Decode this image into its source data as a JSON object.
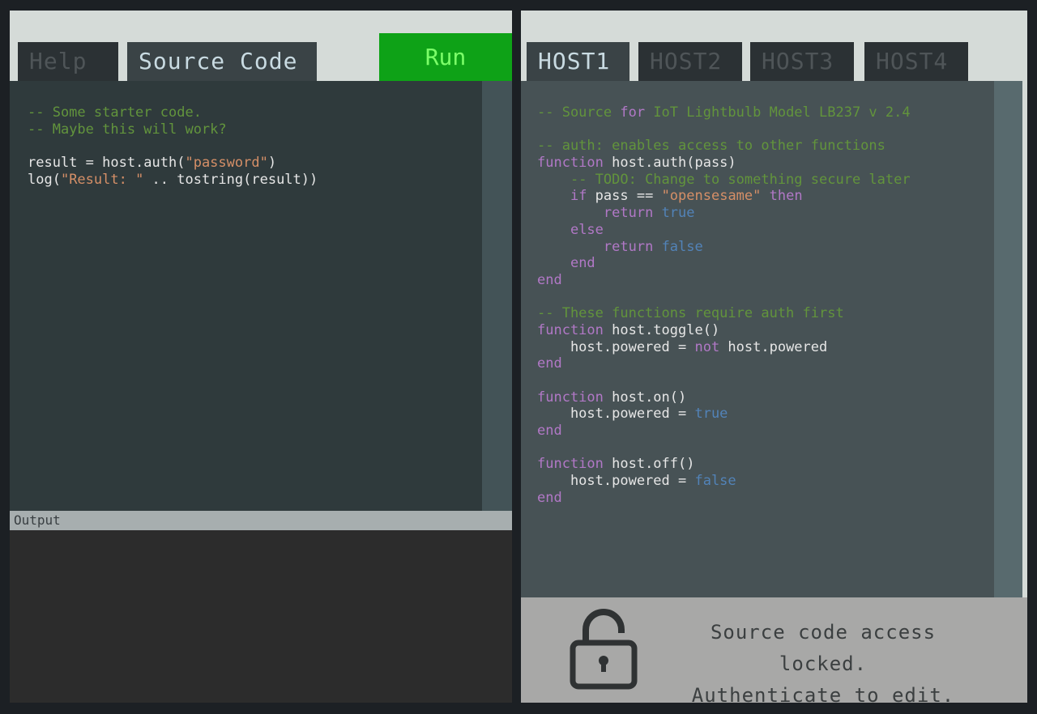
{
  "left": {
    "tabs": [
      "Help",
      "Source Code"
    ],
    "active_tab": "Source Code",
    "run_label": "Run",
    "output_label": "Output",
    "code_lines": [
      [
        [
          "cm",
          "-- Some starter code."
        ]
      ],
      [
        [
          "cm",
          "-- Maybe this will work?"
        ]
      ],
      [],
      [
        [
          "tx",
          "result = host.auth("
        ],
        [
          "str",
          "\"password\""
        ],
        [
          "tx",
          ")"
        ]
      ],
      [
        [
          "tx",
          "log("
        ],
        [
          "str",
          "\"Result: \""
        ],
        [
          "tx",
          " .. tostring(result))"
        ]
      ]
    ]
  },
  "right": {
    "tabs": [
      "HOST1",
      "HOST2",
      "HOST3",
      "HOST4"
    ],
    "active_tab": "HOST1",
    "code_lines": [
      [
        [
          "cm",
          "-- Source "
        ],
        [
          "kw",
          "for"
        ],
        [
          "cm",
          " IoT Lightbulb Model LB237 v 2.4"
        ]
      ],
      [],
      [
        [
          "cm",
          "-- auth: enables access to other functions"
        ]
      ],
      [
        [
          "kw",
          "function"
        ],
        [
          "tx",
          " host.auth(pass)"
        ]
      ],
      [
        [
          "tx",
          "    "
        ],
        [
          "cm",
          "-- TODO: Change to something secure later"
        ]
      ],
      [
        [
          "tx",
          "    "
        ],
        [
          "kw",
          "if"
        ],
        [
          "tx",
          " pass == "
        ],
        [
          "str",
          "\"opensesame\""
        ],
        [
          "tx",
          " "
        ],
        [
          "kw",
          "then"
        ]
      ],
      [
        [
          "tx",
          "        "
        ],
        [
          "kw",
          "return"
        ],
        [
          "tx",
          " "
        ],
        [
          "bool",
          "true"
        ]
      ],
      [
        [
          "tx",
          "    "
        ],
        [
          "kw",
          "else"
        ]
      ],
      [
        [
          "tx",
          "        "
        ],
        [
          "kw",
          "return"
        ],
        [
          "tx",
          " "
        ],
        [
          "bool",
          "false"
        ]
      ],
      [
        [
          "tx",
          "    "
        ],
        [
          "kw",
          "end"
        ]
      ],
      [
        [
          "kw",
          "end"
        ]
      ],
      [],
      [
        [
          "cm",
          "-- These functions require auth first"
        ]
      ],
      [
        [
          "kw",
          "function"
        ],
        [
          "tx",
          " host.toggle()"
        ]
      ],
      [
        [
          "tx",
          "    host.powered = "
        ],
        [
          "kw",
          "not"
        ],
        [
          "tx",
          " host.powered"
        ]
      ],
      [
        [
          "kw",
          "end"
        ]
      ],
      [],
      [
        [
          "kw",
          "function"
        ],
        [
          "tx",
          " host.on()"
        ]
      ],
      [
        [
          "tx",
          "    host.powered = "
        ],
        [
          "bool",
          "true"
        ]
      ],
      [
        [
          "kw",
          "end"
        ]
      ],
      [],
      [
        [
          "kw",
          "function"
        ],
        [
          "tx",
          " host.off()"
        ]
      ],
      [
        [
          "tx",
          "    host.powered = "
        ],
        [
          "bool",
          "false"
        ]
      ],
      [
        [
          "kw",
          "end"
        ]
      ]
    ],
    "lock_message": [
      "Source code access locked.",
      "Authenticate to edit."
    ],
    "lock_icon": "padlock-icon"
  },
  "colors": {
    "comment": "#62943c",
    "string": "#d58f67",
    "keyword": "#b178c6",
    "boolean": "#5283b8",
    "text": "#e6e6e6",
    "run_button_bg": "#0ea217",
    "run_button_text": "#7cff69"
  }
}
